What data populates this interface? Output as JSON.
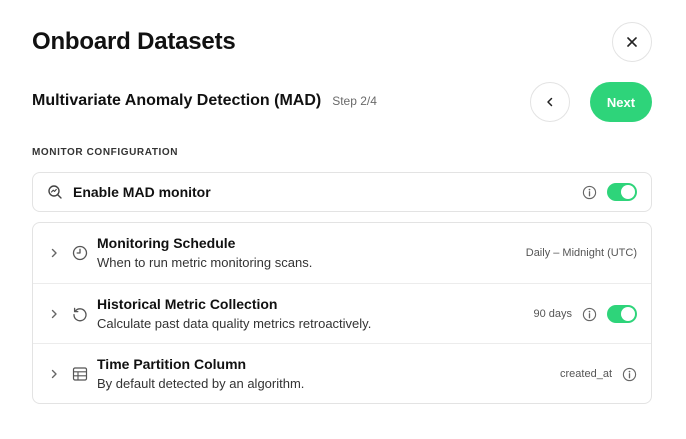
{
  "header": {
    "title": "Onboard Datasets",
    "close_icon": "close-icon"
  },
  "wizard": {
    "subtitle": "Multivariate Anomaly Detection (MAD)",
    "step": "Step 2/4",
    "back_icon": "chevron-left-icon",
    "next_label": "Next",
    "accent_color": "#2ed47a"
  },
  "section": {
    "label": "MONITOR CONFIGURATION"
  },
  "enable": {
    "label": "Enable MAD monitor",
    "icon": "search-chart-icon",
    "enabled": true
  },
  "rows": [
    {
      "title": "Monitoring Schedule",
      "description": "When to run metric monitoring scans.",
      "value": "Daily – Midnight (UTC)",
      "icon": "clock-icon",
      "has_info": false,
      "has_toggle": false
    },
    {
      "title": "Historical Metric Collection",
      "description": "Calculate past data quality metrics retroactively.",
      "value": "90 days",
      "icon": "history-icon",
      "has_info": true,
      "has_toggle": true,
      "enabled": true
    },
    {
      "title": "Time Partition Column",
      "description": "By default detected by an algorithm.",
      "value": "created_at",
      "icon": "table-icon",
      "has_info": true,
      "has_toggle": false
    }
  ]
}
